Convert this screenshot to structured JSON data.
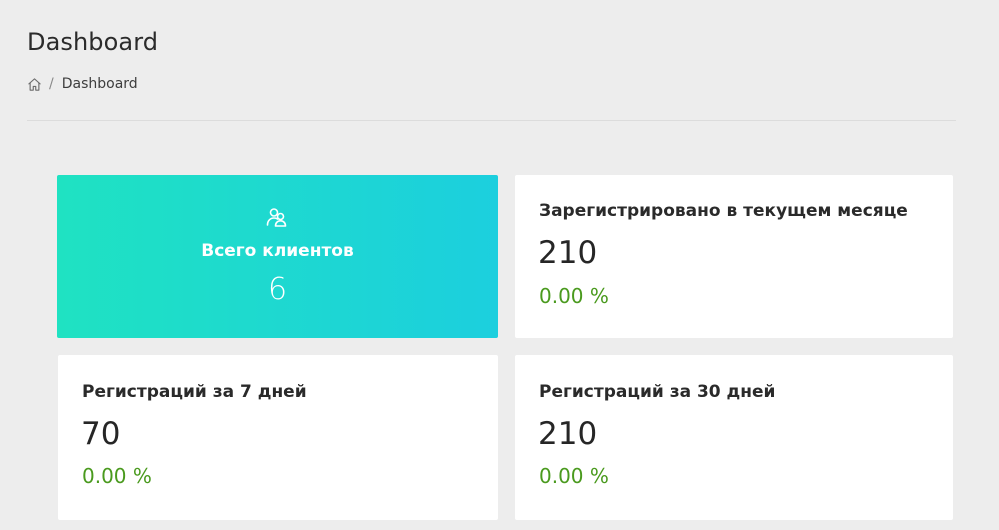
{
  "header": {
    "title": "Dashboard"
  },
  "breadcrumb": {
    "home_icon": "home-icon",
    "separator": "/",
    "current": "Dashboard"
  },
  "cards": {
    "total_clients": {
      "icon": "users-icon",
      "label": "Всего клиентов",
      "value": "6",
      "gradient": [
        "#1fe2c2",
        "#1ccfde"
      ]
    },
    "current_month": {
      "label": "Зарегистрировано в текущем месяце",
      "value": "210",
      "change": "0.00 %"
    },
    "last_7_days": {
      "label": "Регистраций за 7 дней",
      "value": "70",
      "change": "0.00 %"
    },
    "last_30_days": {
      "label": "Регистраций за 30 дней",
      "value": "210",
      "change": "0.00 %"
    }
  },
  "colors": {
    "background": "#ededed",
    "card": "#ffffff",
    "positive": "#4a9a1e"
  }
}
